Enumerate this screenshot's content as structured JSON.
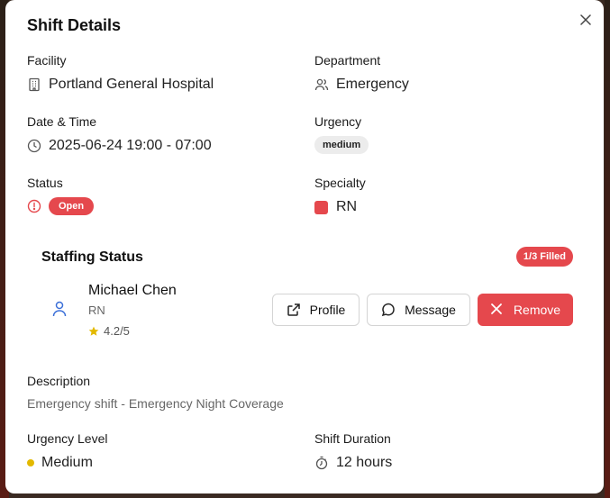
{
  "dialog": {
    "title": "Shift Details",
    "close_icon": "close-icon"
  },
  "fields": {
    "facility": {
      "label": "Facility",
      "value": "Portland General Hospital",
      "icon": "building-icon"
    },
    "department": {
      "label": "Department",
      "value": "Emergency",
      "icon": "users-icon"
    },
    "date_time": {
      "label": "Date & Time",
      "value": "2025-06-24 19:00 - 07:00",
      "icon": "clock-icon"
    },
    "urgency": {
      "label": "Urgency",
      "value": "medium"
    },
    "status": {
      "label": "Status",
      "value": "Open",
      "icon": "alert-circle-icon"
    },
    "specialty": {
      "label": "Specialty",
      "value": "RN",
      "color": "#e5484d"
    }
  },
  "staffing": {
    "title": "Staffing Status",
    "filled_badge": "1/3 Filled",
    "staff": [
      {
        "name": "Michael Chen",
        "role": "RN",
        "rating": "4.2/5",
        "icon": "user-icon"
      }
    ],
    "buttons": {
      "profile": "Profile",
      "message": "Message",
      "remove": "Remove"
    }
  },
  "description": {
    "label": "Description",
    "text": "Emergency shift - Emergency Night Coverage"
  },
  "urgency_level": {
    "label": "Urgency Level",
    "value": "Medium",
    "color": "#e3b900"
  },
  "shift_duration": {
    "label": "Shift Duration",
    "value": "12 hours",
    "icon": "timer-icon"
  },
  "colors": {
    "accent_red": "#e5484d",
    "user_icon_blue": "#3b6fd8",
    "star_yellow": "#e3b900"
  }
}
